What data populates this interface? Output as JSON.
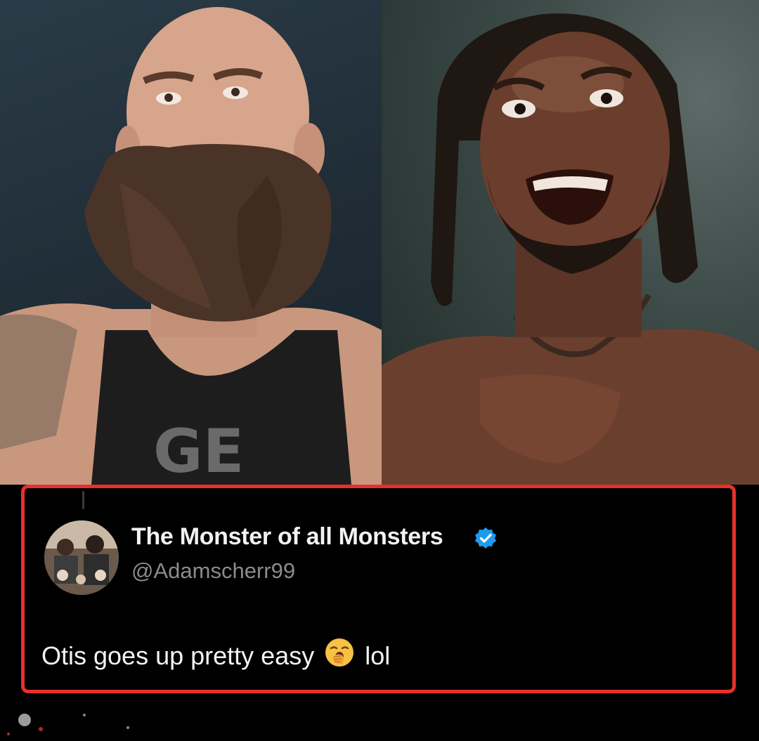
{
  "tweet": {
    "display_name": "The Monster of all Monsters",
    "handle": "@Adamscherr99",
    "text_before": "Otis goes up pretty easy",
    "text_after": "lol",
    "emoji": "yawning-face-emoji",
    "verified": true
  },
  "images": {
    "left_shirt_text": "GE"
  },
  "colors": {
    "highlight_border": "#e8302a",
    "verified_badge": "#1d9bf0",
    "card_background": "#000000",
    "name_text": "#f2f2f2",
    "handle_text": "#8b8b8b"
  }
}
